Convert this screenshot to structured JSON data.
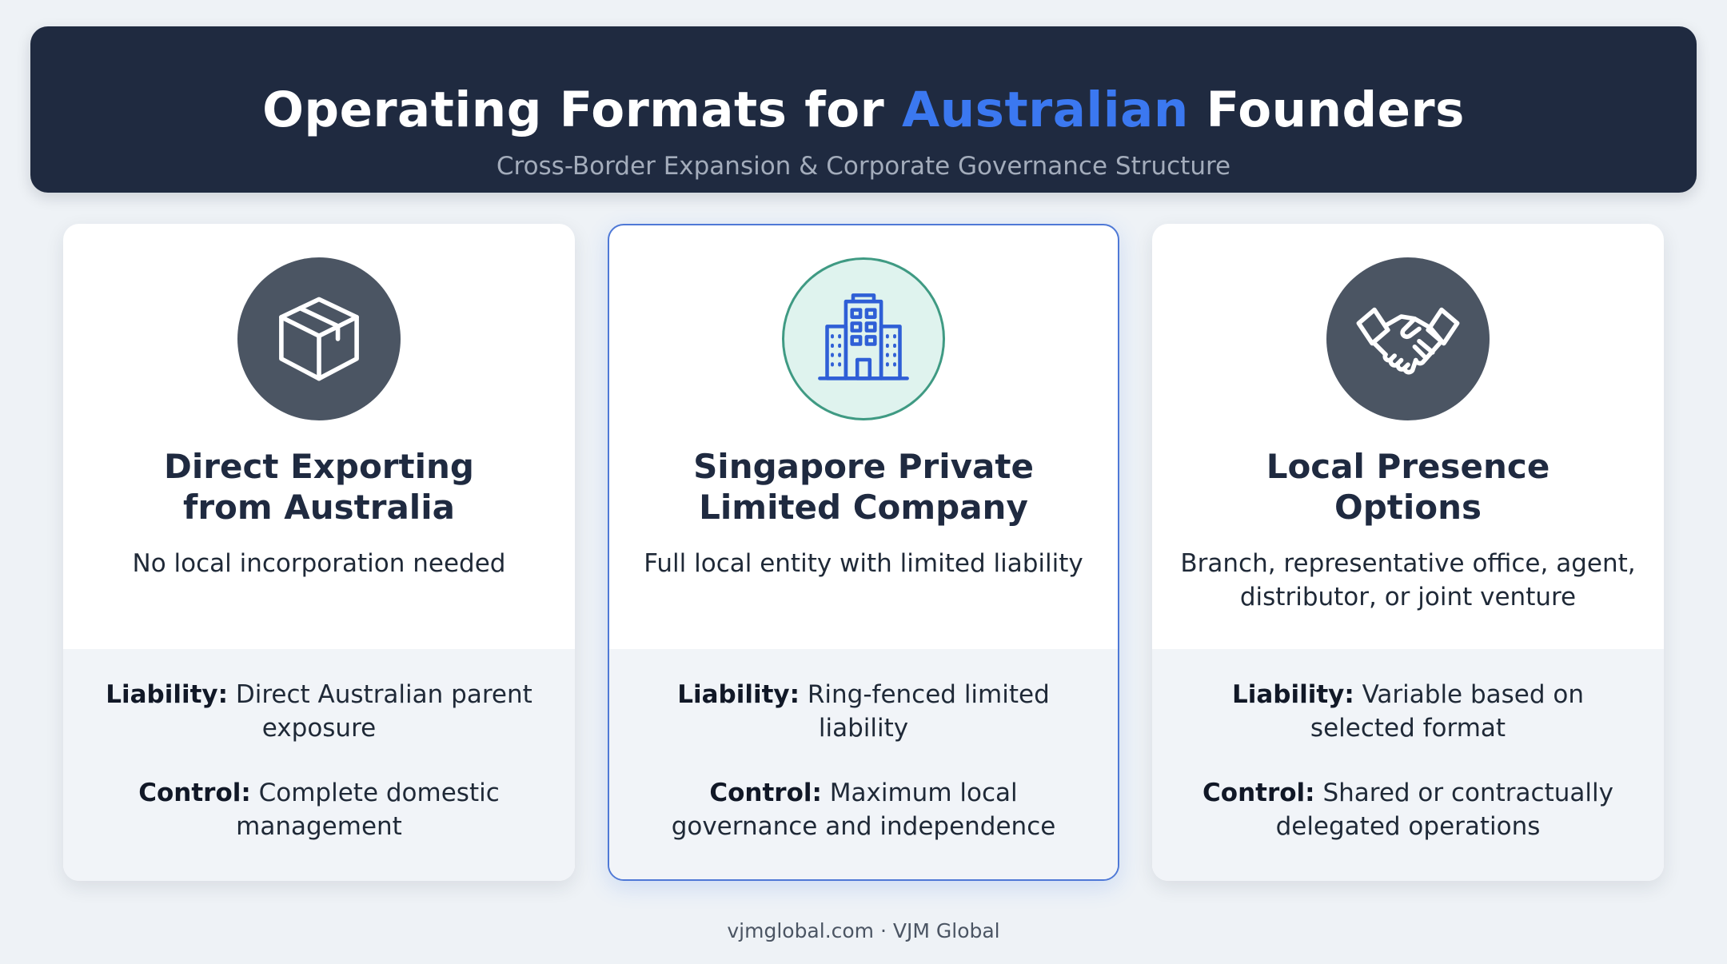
{
  "header": {
    "title_part1": "Operating Formats for",
    "title_accent": "Australian",
    "title_part2": "Founders",
    "subtitle": "Cross-Border Expansion & Corporate Governance Structure"
  },
  "colors": {
    "header_bg": "#1f2a40",
    "accent": "#3b78f0",
    "highlight_border": "#4f79d6",
    "icon_circle_dark": "#4b5563",
    "icon_circle_highlight": "#dff3ee"
  },
  "cards": [
    {
      "icon": "package-box-icon",
      "title_line1": "Direct Exporting",
      "title_line2": "from Australia",
      "description": "No local incorporation needed",
      "liability_label": "Liability:",
      "liability_text": "Direct Australian parent exposure",
      "control_label": "Control:",
      "control_text": "Complete domestic management"
    },
    {
      "icon": "office-building-icon",
      "title_line1": "Singapore Private",
      "title_line2": "Limited Company",
      "description": "Full local entity with limited liability",
      "liability_label": "Liability:",
      "liability_text": "Ring-fenced limited liability",
      "control_label": "Control:",
      "control_text": "Maximum local governance and independence"
    },
    {
      "icon": "handshake-icon",
      "title_line1": "Local Presence",
      "title_line2": "Options",
      "description": "Branch, representative office, agent, distributor, or joint venture",
      "liability_label": "Liability:",
      "liability_text": "Variable based on selected format",
      "control_label": "Control:",
      "control_text": "Shared or contractually delegated operations"
    }
  ],
  "footer": {
    "text": "vjmglobal.com · VJM Global"
  }
}
